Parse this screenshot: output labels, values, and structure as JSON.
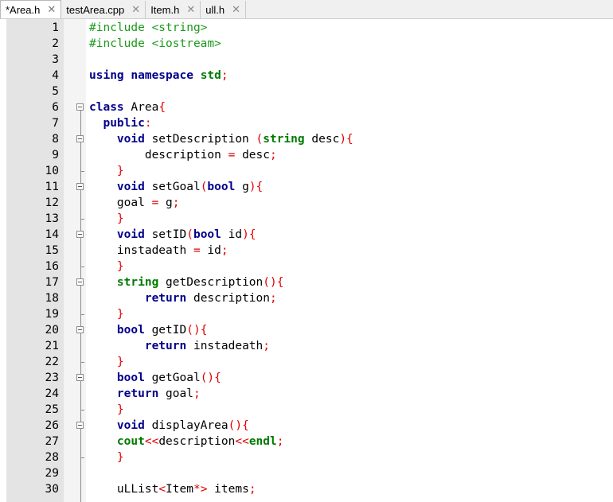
{
  "tabs": [
    {
      "label": "*Area.h",
      "close": "✕"
    },
    {
      "label": "testArea.cpp",
      "close": "✕"
    },
    {
      "label": "Item.h",
      "close": "✕"
    },
    {
      "label": "ull.h",
      "close": "✕"
    }
  ],
  "lines": [
    {
      "n": "1",
      "t": [
        [
          "pp",
          "#include <string>"
        ]
      ]
    },
    {
      "n": "2",
      "t": [
        [
          "pp",
          "#include <iostream>"
        ]
      ]
    },
    {
      "n": "3",
      "t": []
    },
    {
      "n": "4",
      "t": [
        [
          "kw",
          "using"
        ],
        [
          "id",
          " "
        ],
        [
          "kw",
          "namespace"
        ],
        [
          "id",
          " "
        ],
        [
          "ty",
          "std"
        ],
        [
          "op",
          ";"
        ]
      ]
    },
    {
      "n": "5",
      "t": []
    },
    {
      "n": "6",
      "t": [
        [
          "kw",
          "class"
        ],
        [
          "id",
          " Area"
        ],
        [
          "op",
          "{"
        ]
      ]
    },
    {
      "n": "7",
      "t": [
        [
          "id",
          "  "
        ],
        [
          "kw",
          "public"
        ],
        [
          "op",
          ":"
        ]
      ]
    },
    {
      "n": "8",
      "t": [
        [
          "id",
          "    "
        ],
        [
          "kw",
          "void"
        ],
        [
          "id",
          " setDescription "
        ],
        [
          "op",
          "("
        ],
        [
          "ty",
          "string"
        ],
        [
          "id",
          " desc"
        ],
        [
          "op",
          ")"
        ],
        [
          "op",
          "{"
        ]
      ]
    },
    {
      "n": "9",
      "t": [
        [
          "id",
          "        description "
        ],
        [
          "op",
          "="
        ],
        [
          "id",
          " desc"
        ],
        [
          "op",
          ";"
        ]
      ]
    },
    {
      "n": "10",
      "t": [
        [
          "id",
          "    "
        ],
        [
          "op",
          "}"
        ]
      ]
    },
    {
      "n": "11",
      "t": [
        [
          "id",
          "    "
        ],
        [
          "kw",
          "void"
        ],
        [
          "id",
          " setGoal"
        ],
        [
          "op",
          "("
        ],
        [
          "kw",
          "bool"
        ],
        [
          "id",
          " g"
        ],
        [
          "op",
          ")"
        ],
        [
          "op",
          "{"
        ]
      ]
    },
    {
      "n": "12",
      "t": [
        [
          "id",
          "    goal "
        ],
        [
          "op",
          "="
        ],
        [
          "id",
          " g"
        ],
        [
          "op",
          ";"
        ]
      ]
    },
    {
      "n": "13",
      "t": [
        [
          "id",
          "    "
        ],
        [
          "op",
          "}"
        ]
      ]
    },
    {
      "n": "14",
      "t": [
        [
          "id",
          "    "
        ],
        [
          "kw",
          "void"
        ],
        [
          "id",
          " setID"
        ],
        [
          "op",
          "("
        ],
        [
          "kw",
          "bool"
        ],
        [
          "id",
          " id"
        ],
        [
          "op",
          ")"
        ],
        [
          "op",
          "{"
        ]
      ]
    },
    {
      "n": "15",
      "t": [
        [
          "id",
          "    instadeath "
        ],
        [
          "op",
          "="
        ],
        [
          "id",
          " id"
        ],
        [
          "op",
          ";"
        ]
      ]
    },
    {
      "n": "16",
      "t": [
        [
          "id",
          "    "
        ],
        [
          "op",
          "}"
        ]
      ]
    },
    {
      "n": "17",
      "t": [
        [
          "id",
          "    "
        ],
        [
          "ty",
          "string"
        ],
        [
          "id",
          " getDescription"
        ],
        [
          "op",
          "()"
        ],
        [
          "op",
          "{"
        ]
      ]
    },
    {
      "n": "18",
      "t": [
        [
          "id",
          "        "
        ],
        [
          "kw",
          "return"
        ],
        [
          "id",
          " description"
        ],
        [
          "op",
          ";"
        ]
      ]
    },
    {
      "n": "19",
      "t": [
        [
          "id",
          "    "
        ],
        [
          "op",
          "}"
        ]
      ]
    },
    {
      "n": "20",
      "t": [
        [
          "id",
          "    "
        ],
        [
          "kw",
          "bool"
        ],
        [
          "id",
          " getID"
        ],
        [
          "op",
          "()"
        ],
        [
          "op",
          "{"
        ]
      ]
    },
    {
      "n": "21",
      "t": [
        [
          "id",
          "        "
        ],
        [
          "kw",
          "return"
        ],
        [
          "id",
          " instadeath"
        ],
        [
          "op",
          ";"
        ]
      ]
    },
    {
      "n": "22",
      "t": [
        [
          "id",
          "    "
        ],
        [
          "op",
          "}"
        ]
      ]
    },
    {
      "n": "23",
      "t": [
        [
          "id",
          "    "
        ],
        [
          "kw",
          "bool"
        ],
        [
          "id",
          " getGoal"
        ],
        [
          "op",
          "()"
        ],
        [
          "op",
          "{"
        ]
      ]
    },
    {
      "n": "24",
      "t": [
        [
          "id",
          "    "
        ],
        [
          "kw",
          "return"
        ],
        [
          "id",
          " goal"
        ],
        [
          "op",
          ";"
        ]
      ]
    },
    {
      "n": "25",
      "t": [
        [
          "id",
          "    "
        ],
        [
          "op",
          "}"
        ]
      ]
    },
    {
      "n": "26",
      "t": [
        [
          "id",
          "    "
        ],
        [
          "kw",
          "void"
        ],
        [
          "id",
          " displayArea"
        ],
        [
          "op",
          "()"
        ],
        [
          "op",
          "{"
        ]
      ]
    },
    {
      "n": "27",
      "t": [
        [
          "id",
          "    "
        ],
        [
          "ty",
          "cout"
        ],
        [
          "op",
          "<<"
        ],
        [
          "id",
          "description"
        ],
        [
          "op",
          "<<"
        ],
        [
          "ty",
          "endl"
        ],
        [
          "op",
          ";"
        ]
      ]
    },
    {
      "n": "28",
      "t": [
        [
          "id",
          "    "
        ],
        [
          "op",
          "}"
        ]
      ]
    },
    {
      "n": "29",
      "t": []
    },
    {
      "n": "30",
      "t": [
        [
          "id",
          "    uLList"
        ],
        [
          "op",
          "<"
        ],
        [
          "id",
          "Item"
        ],
        [
          "op",
          "*>"
        ],
        [
          "id",
          " items"
        ],
        [
          "op",
          ";"
        ]
      ]
    }
  ],
  "fold_markers": {
    "boxes": [
      6,
      8,
      11,
      14,
      17,
      20,
      23,
      26
    ],
    "ends": [
      10,
      13,
      16,
      19,
      22,
      25,
      28
    ]
  },
  "colors": {
    "keyword": "#00008b",
    "type": "#007a00",
    "preprocessor": "#1a9a1a",
    "operator": "#e00000"
  }
}
